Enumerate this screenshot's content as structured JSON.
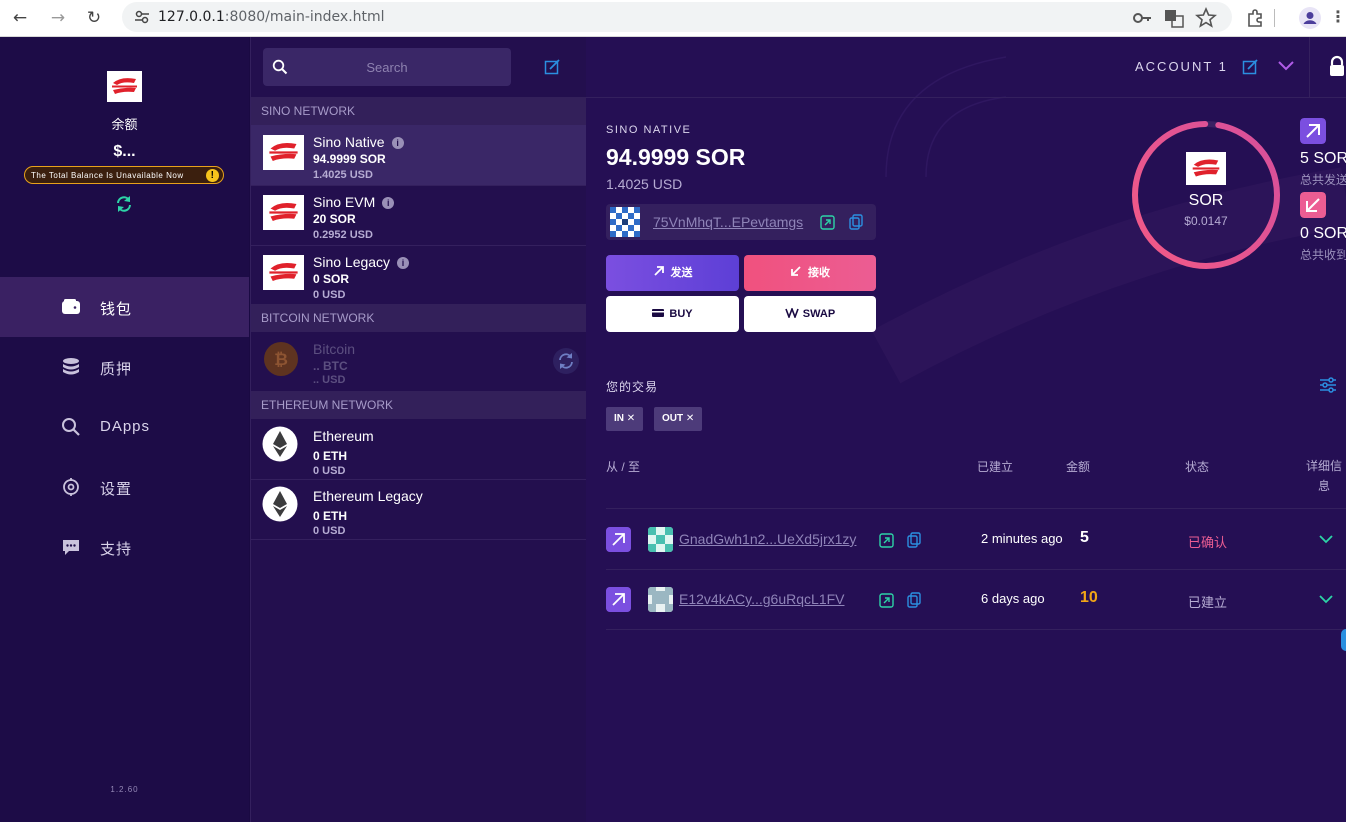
{
  "browser": {
    "url_host": "127.0.0.1",
    "url_rest": ":8080/main-index.html",
    "back_glyph": "←",
    "forward_glyph": "→",
    "reload_glyph": "↻"
  },
  "sidebar": {
    "balance_label": "余额",
    "balance_value": "$...",
    "warning_text": "The Total Balance Is Unavailable Now",
    "warning_mark": "!",
    "items": [
      {
        "label": "钱包",
        "icon": "wallet-icon",
        "active": true
      },
      {
        "label": "质押",
        "icon": "database-icon",
        "active": false
      },
      {
        "label": "DApps",
        "icon": "search-icon",
        "active": false
      },
      {
        "label": "设置",
        "icon": "settings-icon",
        "active": false
      },
      {
        "label": "支持",
        "icon": "chat-icon",
        "active": false
      }
    ],
    "version": "1.2.60"
  },
  "assets": {
    "search_placeholder": "Search",
    "networks": [
      {
        "name": "SINO NETWORK"
      },
      {
        "name": "BITCOIN NETWORK"
      },
      {
        "name": "ETHEREUM NETWORK"
      }
    ],
    "items": [
      {
        "name": "Sino Native",
        "amount": "94.9999 SOR",
        "usd": "1.4025 USD",
        "info": "i"
      },
      {
        "name": "Sino EVM",
        "amount": "20 SOR",
        "usd": "0.2952 USD",
        "info": "i"
      },
      {
        "name": "Sino Legacy",
        "amount": "0 SOR",
        "usd": "0 USD",
        "info": "i"
      },
      {
        "name": "Bitcoin",
        "amount": ".. BTC",
        "usd": ".. USD"
      },
      {
        "name": "Ethereum",
        "amount": "0 ETH",
        "usd": "0 USD"
      },
      {
        "name": "Ethereum Legacy",
        "amount": "0 ETH",
        "usd": "0 USD"
      }
    ]
  },
  "main": {
    "account_label": "ACCOUNT 1",
    "network_title": "SINO NATIVE",
    "balance": "94.9999 SOR",
    "balance_usd": "1.4025 USD",
    "address": "75VnMhqT...EPevtamgs",
    "buttons": {
      "send": "发送",
      "receive": "接收",
      "buy": "BUY",
      "swap": "SWAP"
    },
    "ring": {
      "symbol": "SOR",
      "price": "$0.0147",
      "fraction": 0.97
    },
    "sent": {
      "amount": "5 SOR",
      "label": "总共发送"
    },
    "received": {
      "amount": "0 SOR",
      "label": "总共收到"
    },
    "transactions_title": "您的交易",
    "filters": [
      "IN",
      "OUT"
    ],
    "filter_close": "✕",
    "columns": {
      "from_to": "从 / 至",
      "created": "已建立",
      "amount": "金额",
      "status": "状态",
      "details": "详细信息"
    },
    "transactions": [
      {
        "address": "GnadGwh1n2...UeXd5jrx1zy",
        "time": "2 minutes ago",
        "amount": "5",
        "status": "已确认",
        "amount_color": "#ffffff",
        "status_color": "#ec5d93"
      },
      {
        "address": "E12v4kACy...g6uRqcL1FV",
        "time": "6 days ago",
        "amount": "10",
        "status": "已建立",
        "amount_color": "#f2a516",
        "status_color": "#b6acd3"
      }
    ]
  },
  "colors": {
    "accent_teal": "#2dd4a7",
    "accent_blue": "#2b8fe0",
    "accent_purple": "#7b4fe0",
    "accent_pink": "#ec5d93"
  }
}
